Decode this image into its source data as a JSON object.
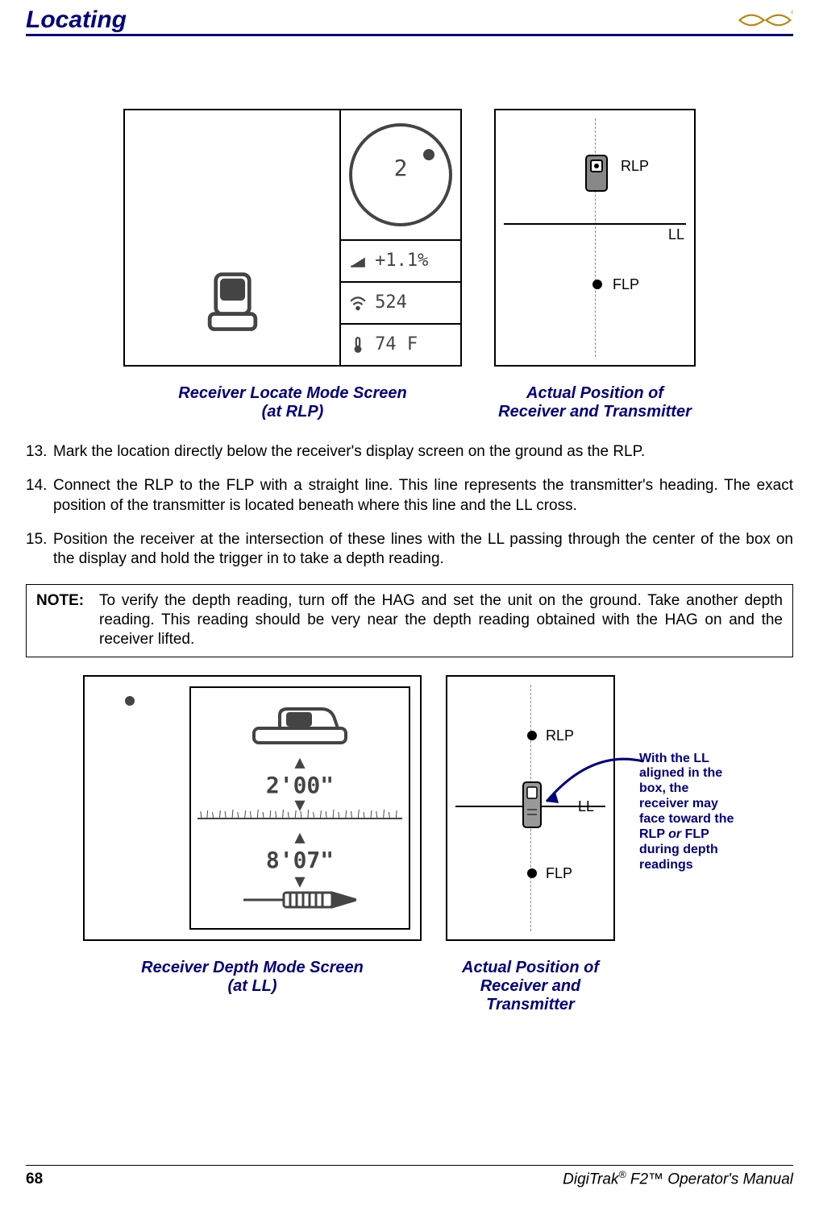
{
  "header": {
    "title": "Locating"
  },
  "fig1": {
    "dial_value": "2",
    "pitch": "+1.1%",
    "signal": "524",
    "temp": "74 F",
    "pos": {
      "rlp": "RLP",
      "ll": "LL",
      "flp": "FLP"
    },
    "cap_left_l1": "Receiver Locate Mode Screen",
    "cap_left_l2": "(at RLP)",
    "cap_right_l1": "Actual Position of",
    "cap_right_l2": "Receiver and Transmitter"
  },
  "steps": {
    "s13_n": "13.",
    "s13_t": "Mark the location directly below the receiver's display screen on the ground as the RLP.",
    "s14_n": "14.",
    "s14_t": "Connect the RLP to the FLP with a straight line. This line represents the transmitter's heading. The exact position of the transmitter is located beneath where this line and the LL cross.",
    "s15_n": "15.",
    "s15_t": "Position the receiver at the intersection of these lines with the LL passing through the center of the box on the display and hold the trigger in to take a depth reading."
  },
  "note": {
    "label": "NOTE:",
    "text": "To verify the depth reading, turn off the HAG and set the unit on the ground. Take another depth reading. This reading should be very near the depth reading obtained with the HAG on and the receiver lifted."
  },
  "fig2": {
    "val_top": "2'00\"",
    "val_bot": "8'07\"",
    "pos": {
      "rlp": "RLP",
      "ll": "LL",
      "flp": "FLP"
    },
    "cap_left_l1": "Receiver Depth Mode Screen",
    "cap_left_l2": "(at LL)",
    "cap_right_l1": "Actual Position of",
    "cap_right_l2": "Receiver and Transmitter",
    "callout_a": "With the LL aligned in the box, the receiver may face toward the RLP ",
    "callout_or": "or",
    "callout_b": " FLP during depth readings"
  },
  "footer": {
    "page": "68",
    "title_a": "DigiTrak",
    "title_sup1": "®",
    "title_b": " F2",
    "title_tm": "™",
    "title_c": " Operator's Manual"
  }
}
